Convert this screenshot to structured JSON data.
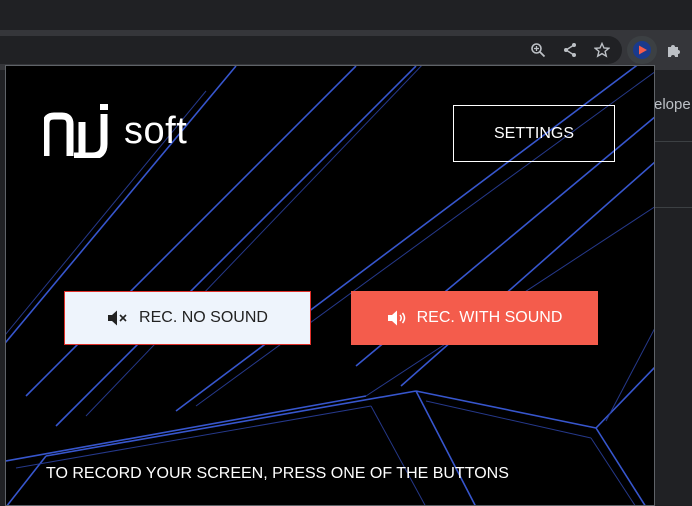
{
  "browser": {
    "background_text": "elope"
  },
  "popup": {
    "logo_text": "soft",
    "settings_label": "SETTINGS",
    "rec_no_sound_label": "REC. NO SOUND",
    "rec_with_sound_label": "REC. WITH SOUND",
    "hint_text": "TO RECORD YOUR SCREEN, PRESS ONE OF THE BUTTONS"
  },
  "colors": {
    "accent_red": "#f45c4c",
    "line_blue": "#3a5bd9",
    "popup_bg": "#000000"
  },
  "icons": [
    "zoom-icon",
    "share-icon",
    "star-icon",
    "recorder-extension-icon",
    "puzzle-icon",
    "muted-speaker-icon",
    "speaker-icon"
  ]
}
